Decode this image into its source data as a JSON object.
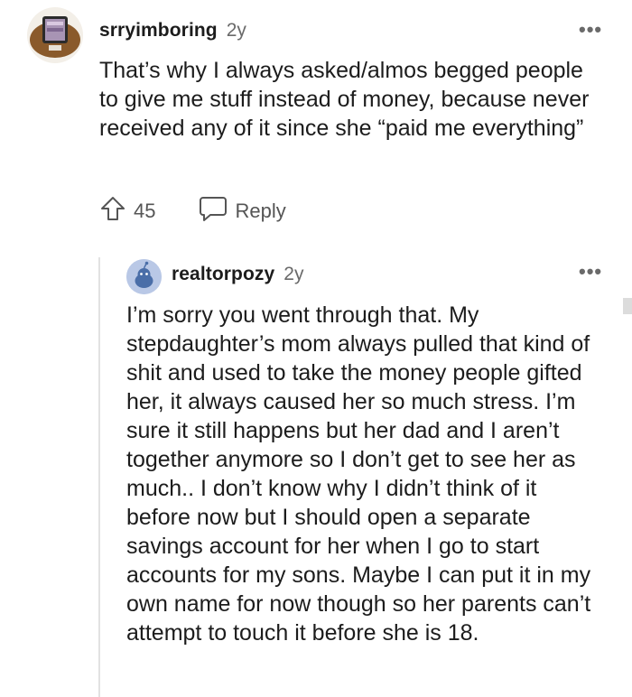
{
  "comment": {
    "username": "srryimboring",
    "age": "2y",
    "more": "•••",
    "body": "That’s why I always asked/almos begged people to give me stuff instead of money, because never received any of it since she “paid me everything”",
    "upvotes": "45",
    "reply_label": "Reply"
  },
  "reply": {
    "username": "realtorpozy",
    "age": "2y",
    "more": "•••",
    "body": "I’m sorry you went through that. My stepdaughter’s mom always pulled that kind of shit and used to take the money people gifted her, it always caused her so much stress. I’m sure it still happens but her dad and I aren’t together anymore so I don’t get to see her as much.. I don’t know why I didn’t think of it before now but I should open a separate savings account for her when I go to start accounts for my sons. Maybe I can put it in my own name for now though so her parents can’t attempt to touch it before she is 18."
  },
  "colors": {
    "text": "#1c1c1c",
    "meta": "#6a6a6a",
    "thread_line": "#e2e2e2"
  },
  "icons": [
    "upvote-arrow-icon",
    "speech-bubble-icon",
    "more-options-icon",
    "reddit-snoo-icon"
  ]
}
